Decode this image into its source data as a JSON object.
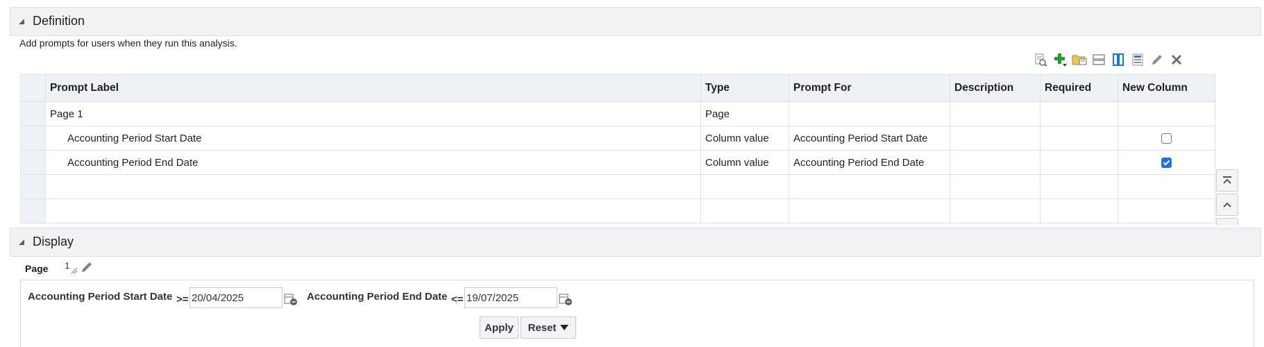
{
  "definition": {
    "title": "Definition",
    "description": "Add prompts for users when they run this analysis.",
    "columns": [
      "Prompt Label",
      "Type",
      "Prompt For",
      "Description",
      "Required",
      "New Column"
    ],
    "rows": [
      {
        "label": "Page 1",
        "type": "Page",
        "prompt_for": "",
        "description": "",
        "required": "",
        "new_column": null
      },
      {
        "label": "Accounting Period Start Date",
        "type": "Column value",
        "prompt_for": "Accounting Period Start Date",
        "description": "",
        "required": "",
        "new_column": false
      },
      {
        "label": "Accounting Period End Date",
        "type": "Column value",
        "prompt_for": "Accounting Period End Date",
        "description": "",
        "required": "",
        "new_column": true
      }
    ]
  },
  "toolbar_icons": [
    "preview-icon",
    "add-icon",
    "folder-icon",
    "row-layout-icon",
    "column-layout-icon",
    "page-settings-icon",
    "edit-icon",
    "delete-icon"
  ],
  "display": {
    "title": "Display",
    "page_label": "Page",
    "page_number": "1",
    "prompts": [
      {
        "label": "Accounting Period Start Date",
        "operator": ">=",
        "value": "20/04/2025"
      },
      {
        "label": "Accounting Period End Date",
        "operator": "<=",
        "value": "19/07/2025"
      }
    ],
    "apply_label": "Apply",
    "reset_label": "Reset"
  },
  "colors": {
    "accent_blue": "#1a73e8",
    "add_green": "#2e9b2e",
    "header_bg": "#f1f2f4"
  }
}
